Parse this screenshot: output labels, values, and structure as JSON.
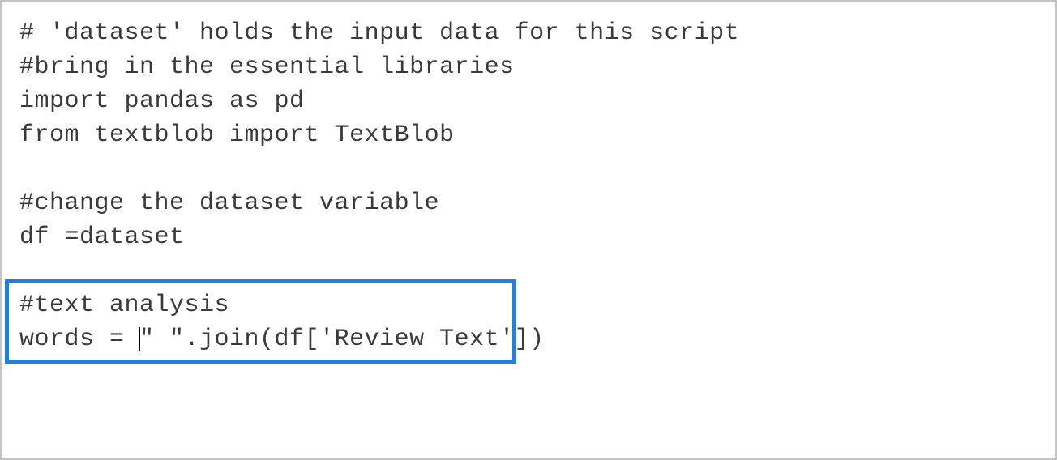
{
  "editor": {
    "lines": [
      "# 'dataset' holds the input data for this script",
      "#bring in the essential libraries",
      "import pandas as pd",
      "from textblob import TextBlob",
      "",
      "#change the dataset variable",
      "df =dataset",
      "",
      "#text analysis",
      "words = |\" \".join(df['Review Text'])"
    ],
    "line1": "# 'dataset' holds the input data for this script",
    "line2": "#bring in the essential libraries",
    "line3": "import pandas as pd",
    "line4": "from textblob import TextBlob",
    "line6": "#change the dataset variable",
    "line7": "df =dataset",
    "line9": "#text analysis",
    "line10_a": "words = ",
    "line10_b": "\" \".join(df['Review Text'])"
  },
  "highlight": {
    "color": "#2b7cd3"
  }
}
